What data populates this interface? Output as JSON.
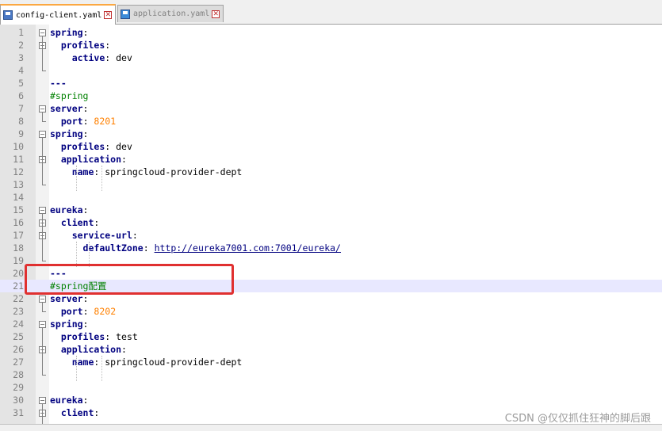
{
  "tabs": [
    {
      "label": "config-client.yaml",
      "active": true
    },
    {
      "label": "application.yaml",
      "active": false
    }
  ],
  "lines": [
    {
      "n": "1",
      "parts": [
        {
          "t": "spring",
          "c": "k"
        },
        {
          "t": ":"
        }
      ]
    },
    {
      "n": "2",
      "parts": [
        {
          "t": "  "
        },
        {
          "t": "profiles",
          "c": "k"
        },
        {
          "t": ":"
        }
      ]
    },
    {
      "n": "3",
      "parts": [
        {
          "t": "    "
        },
        {
          "t": "active",
          "c": "k"
        },
        {
          "t": ": dev"
        }
      ]
    },
    {
      "n": "4",
      "parts": []
    },
    {
      "n": "5",
      "parts": [
        {
          "t": "---",
          "c": "k"
        }
      ]
    },
    {
      "n": "6",
      "parts": [
        {
          "t": "#spring",
          "c": "cm"
        }
      ]
    },
    {
      "n": "7",
      "parts": [
        {
          "t": "server",
          "c": "k"
        },
        {
          "t": ":"
        }
      ]
    },
    {
      "n": "8",
      "parts": [
        {
          "t": "  "
        },
        {
          "t": "port",
          "c": "k"
        },
        {
          "t": ": "
        },
        {
          "t": "8201",
          "c": "num"
        }
      ]
    },
    {
      "n": "9",
      "parts": [
        {
          "t": "spring",
          "c": "k"
        },
        {
          "t": ":"
        }
      ]
    },
    {
      "n": "10",
      "parts": [
        {
          "t": "  "
        },
        {
          "t": "profiles",
          "c": "k"
        },
        {
          "t": ": dev"
        }
      ]
    },
    {
      "n": "11",
      "parts": [
        {
          "t": "  "
        },
        {
          "t": "application",
          "c": "k"
        },
        {
          "t": ":"
        }
      ]
    },
    {
      "n": "12",
      "parts": [
        {
          "t": "    "
        },
        {
          "t": "name",
          "c": "k"
        },
        {
          "t": ": springcloud-provider-dept"
        }
      ]
    },
    {
      "n": "13",
      "parts": []
    },
    {
      "n": "14",
      "parts": []
    },
    {
      "n": "15",
      "parts": [
        {
          "t": "eureka",
          "c": "k"
        },
        {
          "t": ":"
        }
      ]
    },
    {
      "n": "16",
      "parts": [
        {
          "t": "  "
        },
        {
          "t": "client",
          "c": "k"
        },
        {
          "t": ":"
        }
      ]
    },
    {
      "n": "17",
      "parts": [
        {
          "t": "    "
        },
        {
          "t": "service-url",
          "c": "k"
        },
        {
          "t": ":"
        }
      ]
    },
    {
      "n": "18",
      "parts": [
        {
          "t": "      "
        },
        {
          "t": "defaultZone",
          "c": "k"
        },
        {
          "t": ": "
        },
        {
          "t": "http://eureka7001.com:7001/eureka/",
          "c": "link"
        }
      ]
    },
    {
      "n": "19",
      "parts": []
    },
    {
      "n": "20",
      "parts": [
        {
          "t": "---",
          "c": "k"
        }
      ]
    },
    {
      "n": "21",
      "parts": [
        {
          "t": "#spring配置",
          "c": "cm"
        }
      ]
    },
    {
      "n": "22",
      "parts": [
        {
          "t": "server",
          "c": "k"
        },
        {
          "t": ":"
        }
      ]
    },
    {
      "n": "23",
      "parts": [
        {
          "t": "  "
        },
        {
          "t": "port",
          "c": "k"
        },
        {
          "t": ": "
        },
        {
          "t": "8202",
          "c": "num"
        }
      ]
    },
    {
      "n": "24",
      "parts": [
        {
          "t": "spring",
          "c": "k"
        },
        {
          "t": ":"
        }
      ]
    },
    {
      "n": "25",
      "parts": [
        {
          "t": "  "
        },
        {
          "t": "profiles",
          "c": "k"
        },
        {
          "t": ": test"
        }
      ]
    },
    {
      "n": "26",
      "parts": [
        {
          "t": "  "
        },
        {
          "t": "application",
          "c": "k"
        },
        {
          "t": ":"
        }
      ]
    },
    {
      "n": "27",
      "parts": [
        {
          "t": "    "
        },
        {
          "t": "name",
          "c": "k"
        },
        {
          "t": ": springcloud-provider-dept"
        }
      ]
    },
    {
      "n": "28",
      "parts": []
    },
    {
      "n": "29",
      "parts": []
    },
    {
      "n": "30",
      "parts": [
        {
          "t": "eureka",
          "c": "k"
        },
        {
          "t": ":"
        }
      ]
    },
    {
      "n": "31",
      "parts": [
        {
          "t": "  "
        },
        {
          "t": "client",
          "c": "k"
        },
        {
          "t": ":"
        }
      ]
    }
  ],
  "current_line": "21",
  "watermark": "CSDN @仅仅抓住狂神的脚后跟",
  "colors": {
    "keyword": "#000080",
    "comment": "#008000",
    "number": "#ff8000",
    "highlight_box": "#e03030",
    "current_line_bg": "#e8e8ff"
  }
}
